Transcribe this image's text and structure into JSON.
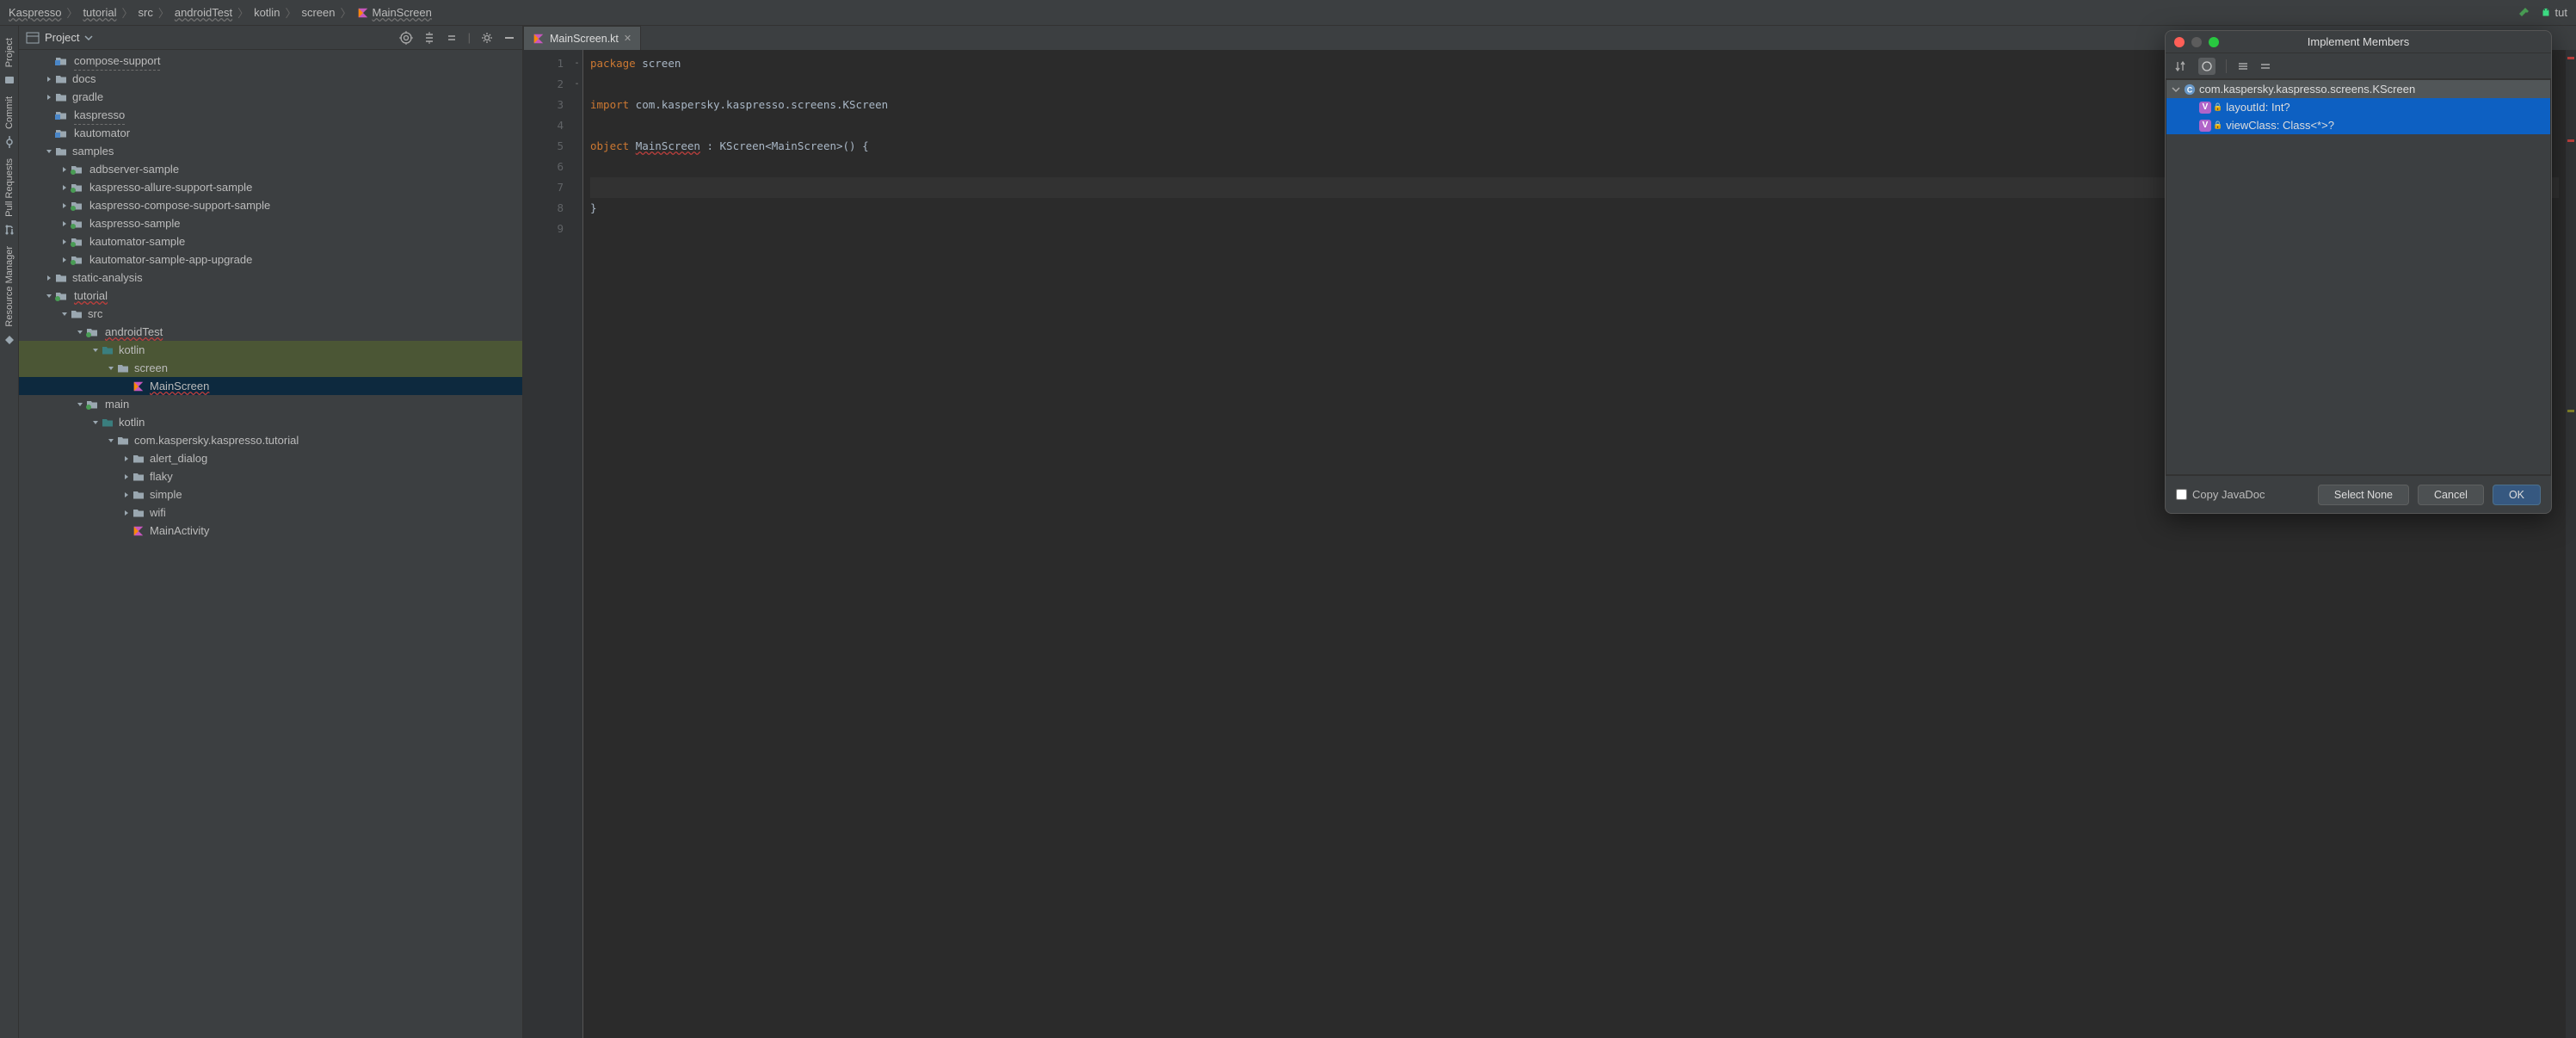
{
  "breadcrumbs": [
    "Kaspresso",
    "tutorial",
    "src",
    "androidTest",
    "kotlin",
    "screen",
    "MainScreen"
  ],
  "top_right_label": "tut",
  "project": {
    "title": "Project",
    "tree": [
      {
        "depth": 1,
        "arrow": "",
        "icon": "folder-blue",
        "label": "compose-support",
        "underline": true
      },
      {
        "depth": 1,
        "arrow": "right",
        "icon": "folder",
        "label": "docs"
      },
      {
        "depth": 1,
        "arrow": "right",
        "icon": "folder",
        "label": "gradle"
      },
      {
        "depth": 1,
        "arrow": "",
        "icon": "folder-blue",
        "label": "kaspresso",
        "underline": true
      },
      {
        "depth": 1,
        "arrow": "",
        "icon": "folder-blue",
        "label": "kautomator"
      },
      {
        "depth": 1,
        "arrow": "down",
        "icon": "folder",
        "label": "samples"
      },
      {
        "depth": 2,
        "arrow": "right",
        "icon": "folder-green",
        "label": "adbserver-sample"
      },
      {
        "depth": 2,
        "arrow": "right",
        "icon": "folder-green",
        "label": "kaspresso-allure-support-sample"
      },
      {
        "depth": 2,
        "arrow": "right",
        "icon": "folder-green",
        "label": "kaspresso-compose-support-sample"
      },
      {
        "depth": 2,
        "arrow": "right",
        "icon": "folder-green",
        "label": "kaspresso-sample"
      },
      {
        "depth": 2,
        "arrow": "right",
        "icon": "folder-green",
        "label": "kautomator-sample"
      },
      {
        "depth": 2,
        "arrow": "right",
        "icon": "folder-green",
        "label": "kautomator-sample-app-upgrade"
      },
      {
        "depth": 1,
        "arrow": "right",
        "icon": "folder",
        "label": "static-analysis"
      },
      {
        "depth": 1,
        "arrow": "down",
        "icon": "folder-green",
        "label": "tutorial",
        "err": true
      },
      {
        "depth": 2,
        "arrow": "down",
        "icon": "folder",
        "label": "src"
      },
      {
        "depth": 3,
        "arrow": "down",
        "icon": "folder-green",
        "label": "androidTest",
        "err": true
      },
      {
        "depth": 4,
        "arrow": "down",
        "icon": "folder-teal",
        "label": "kotlin",
        "highlight": "green"
      },
      {
        "depth": 5,
        "arrow": "down",
        "icon": "folder",
        "label": "screen",
        "highlight": "green"
      },
      {
        "depth": 6,
        "arrow": "",
        "icon": "kotlin",
        "label": "MainScreen",
        "err": true,
        "highlight": "selected"
      },
      {
        "depth": 3,
        "arrow": "down",
        "icon": "folder-green",
        "label": "main"
      },
      {
        "depth": 4,
        "arrow": "down",
        "icon": "folder-teal",
        "label": "kotlin"
      },
      {
        "depth": 5,
        "arrow": "down",
        "icon": "folder",
        "label": "com.kaspersky.kaspresso.tutorial"
      },
      {
        "depth": 6,
        "arrow": "right",
        "icon": "folder",
        "label": "alert_dialog"
      },
      {
        "depth": 6,
        "arrow": "right",
        "icon": "folder",
        "label": "flaky"
      },
      {
        "depth": 6,
        "arrow": "right",
        "icon": "folder",
        "label": "simple"
      },
      {
        "depth": 6,
        "arrow": "right",
        "icon": "folder",
        "label": "wifi"
      },
      {
        "depth": 6,
        "arrow": "",
        "icon": "kotlin",
        "label": "MainActivity"
      }
    ]
  },
  "sidebar_labels": {
    "project": "Project",
    "commit": "Commit",
    "pull": "Pull Requests",
    "resource": "Resource Manager"
  },
  "editor": {
    "tab_name": "MainScreen.kt",
    "lines": [
      {
        "n": 1,
        "html": "<span class='kw'>package</span> screen"
      },
      {
        "n": 2,
        "html": ""
      },
      {
        "n": 3,
        "html": "<span class='kw'>import</span> com.kaspersky.kaspresso.screens.KScreen"
      },
      {
        "n": 4,
        "html": ""
      },
      {
        "n": 5,
        "html": "<span class='kw'>object</span> <span class='err-underline'>MainScreen</span> : KScreen&lt;MainScreen&gt;() {",
        "fold": "-"
      },
      {
        "n": 6,
        "html": ""
      },
      {
        "n": 7,
        "html": "",
        "current": true
      },
      {
        "n": 8,
        "html": "}",
        "fold": "-"
      },
      {
        "n": 9,
        "html": ""
      }
    ]
  },
  "dialog": {
    "title": "Implement Members",
    "root_label": "com.kaspersky.kaspresso.screens.KScreen",
    "members": [
      {
        "label": "layoutId: Int?"
      },
      {
        "label": "viewClass: Class<*>?"
      }
    ],
    "copy_javadoc": "Copy JavaDoc",
    "select_none": "Select None",
    "cancel": "Cancel",
    "ok": "OK"
  }
}
